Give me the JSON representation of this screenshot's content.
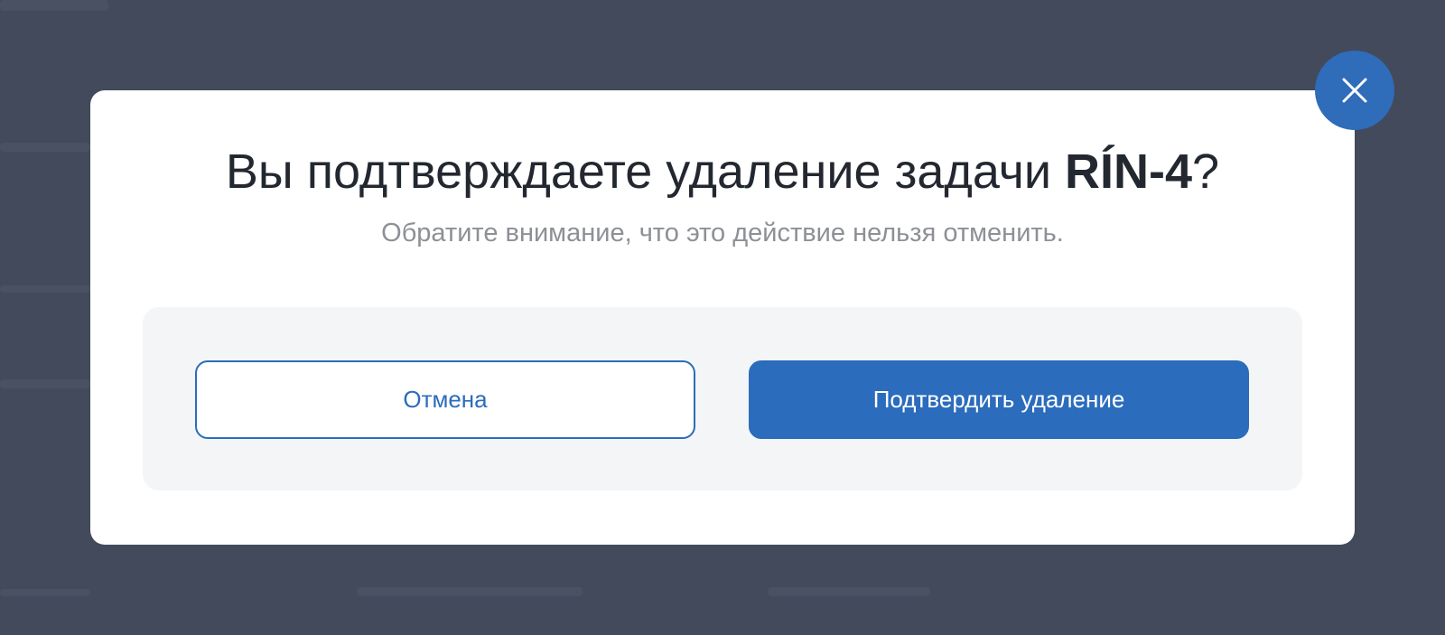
{
  "dialog": {
    "title_prefix": "Вы подтверждаете удаление задачи ",
    "task_key": "RÍN-4",
    "title_suffix": "?",
    "subtitle": "Обратите внимание, что это действие нельзя отменить.",
    "cancel_label": "Отмена",
    "confirm_label": "Подтвердить удаление",
    "close_icon": "close-icon"
  },
  "colors": {
    "accent": "#2b6cbc",
    "overlay": "#424a5b",
    "actions_background": "#f4f5f7"
  }
}
